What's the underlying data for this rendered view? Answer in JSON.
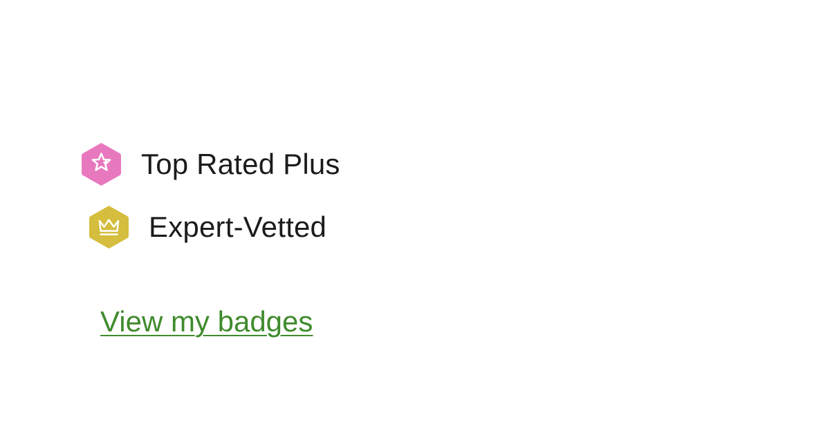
{
  "badges": [
    {
      "label": "Top Rated Plus",
      "icon": "star-plus-icon",
      "color": "#e878be"
    },
    {
      "label": "Expert-Vetted",
      "icon": "crown-icon",
      "color": "#d5bd3d"
    }
  ],
  "link": {
    "label": "View my badges",
    "color": "#3f8b2d"
  },
  "colors": {
    "text": "#1b1b1b",
    "background": "#ffffff"
  }
}
